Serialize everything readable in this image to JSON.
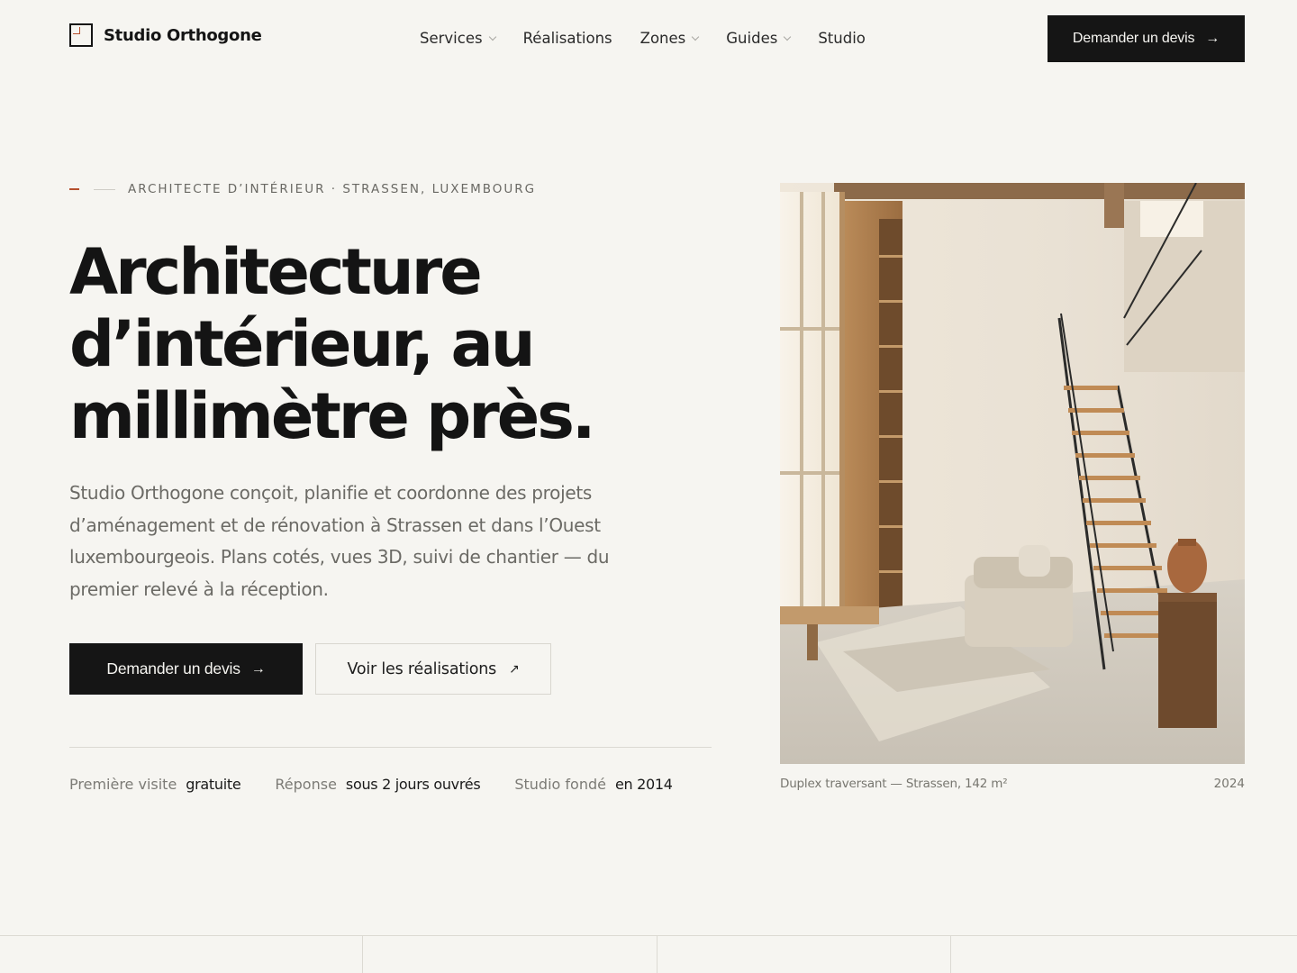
{
  "brand": {
    "name": "Studio Orthogone"
  },
  "nav": {
    "items": [
      {
        "label": "Services",
        "has_dropdown": true
      },
      {
        "label": "Réalisations",
        "has_dropdown": false
      },
      {
        "label": "Zones",
        "has_dropdown": true
      },
      {
        "label": "Guides",
        "has_dropdown": true
      },
      {
        "label": "Studio",
        "has_dropdown": false
      }
    ],
    "cta_label": "Demander un devis"
  },
  "hero": {
    "eyebrow": "ARCHITECTE D’INTÉRIEUR · STRASSEN, LUXEMBOURG",
    "title_lines": [
      "Architecture",
      "d’intérieur, au",
      "millimètre près."
    ],
    "lead": "Studio Orthogone conçoit, planifie et coordonne des projets d’aménagement et de rénovation à Strassen et dans l’Ouest luxembourgeois. Plans cotés, vues 3D, suivi de chantier — du premier relevé à la réception.",
    "primary_cta": "Demander un devis",
    "secondary_cta": "Voir les réalisations",
    "facts": [
      {
        "label": "Première visite",
        "value": "gratuite"
      },
      {
        "label": "Réponse",
        "value": "sous 2 jours ouvrés"
      },
      {
        "label": "Studio fondé",
        "value": "en 2014"
      }
    ]
  },
  "photo": {
    "caption": "Duplex traversant — Strassen, 142 m²",
    "year": "2024"
  },
  "icons": {
    "arrow_right": "→",
    "arrow_up_right": "↗"
  },
  "colors": {
    "background": "#f6f5f1",
    "ink": "#141414",
    "accent": "#b5502e",
    "muted": "#6b6a65"
  }
}
